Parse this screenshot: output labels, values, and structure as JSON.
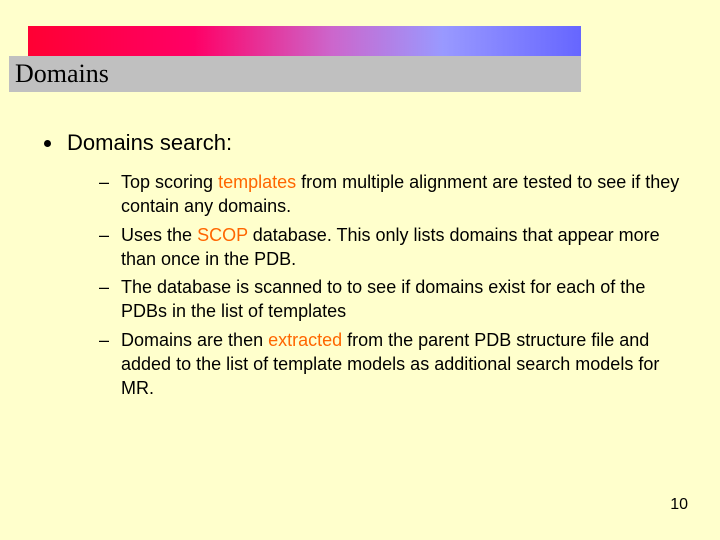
{
  "title": "Domains",
  "main_bullet": "Domains search:",
  "sub_items": [
    {
      "pre": "Top scoring ",
      "hl": "templates",
      "post": " from multiple alignment are tested to see if they contain any domains."
    },
    {
      "pre": "Uses the ",
      "hl": "SCOP",
      "post": " database. This only lists domains that appear more than once in the PDB."
    },
    {
      "pre": "",
      "hl": "",
      "post": "The database is scanned to to see if domains exist for each of the PDBs in the list of templates"
    },
    {
      "pre": "Domains are then ",
      "hl": "extracted",
      "post": " from the parent PDB structure file and added to the list of template models as additional search models for MR."
    }
  ],
  "page_number": "10"
}
